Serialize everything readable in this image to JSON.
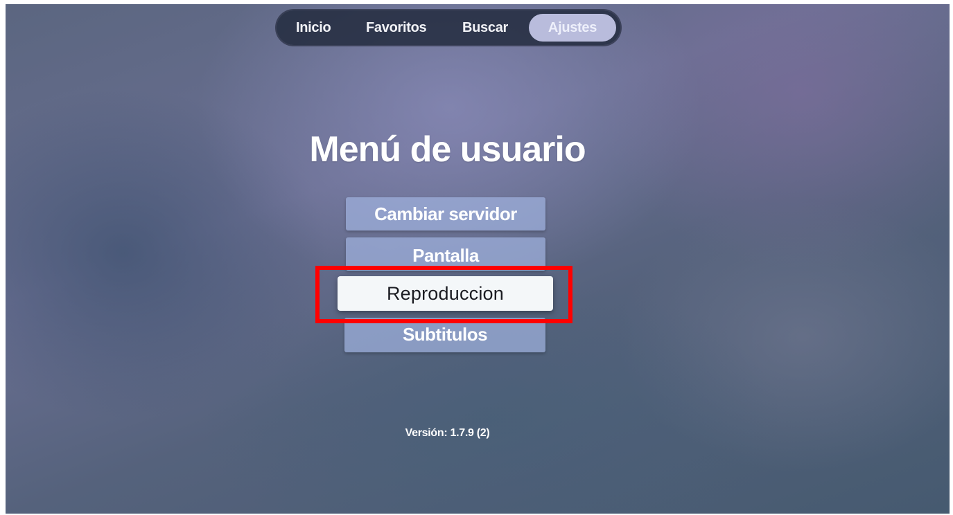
{
  "nav": {
    "tabs": [
      {
        "label": "Inicio",
        "active": false
      },
      {
        "label": "Favoritos",
        "active": false
      },
      {
        "label": "Buscar",
        "active": false
      },
      {
        "label": "Ajustes",
        "active": true
      }
    ]
  },
  "page": {
    "title": "Menú de usuario"
  },
  "menu": {
    "items": [
      {
        "label": "Cambiar servidor",
        "focused": false
      },
      {
        "label": "Pantalla",
        "focused": false
      },
      {
        "label": "Reproduccion",
        "focused": true
      },
      {
        "label": "Subtitulos",
        "focused": false
      }
    ]
  },
  "footer": {
    "version": "Versión: 1.7.9 (2)"
  },
  "colors": {
    "highlight_box": "#ff0000",
    "active_tab": "#b9bcdc",
    "focused_item": "#f4f7f9"
  }
}
